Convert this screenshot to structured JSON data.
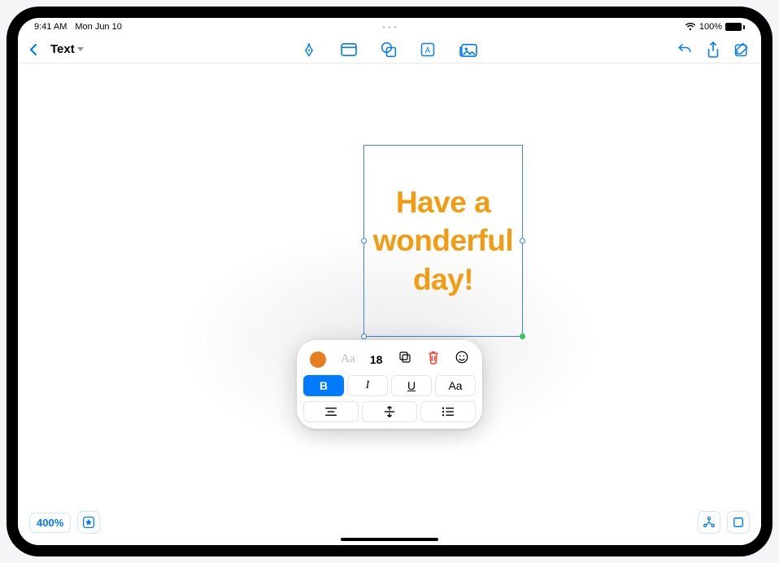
{
  "status": {
    "time": "9:41 AM",
    "date": "Mon Jun 10",
    "battery": "100%"
  },
  "toolbar": {
    "tool_title": "Text"
  },
  "textbox": {
    "content": "Have a wonderful day!",
    "color": "#f39c12"
  },
  "popover": {
    "color": "#e67e22",
    "font_label": "Aa",
    "size": "18",
    "bold_label": "B",
    "italic_label": "I",
    "underline_label": "U",
    "textcase_label": "Aa"
  },
  "bottom": {
    "zoom": "400%"
  }
}
